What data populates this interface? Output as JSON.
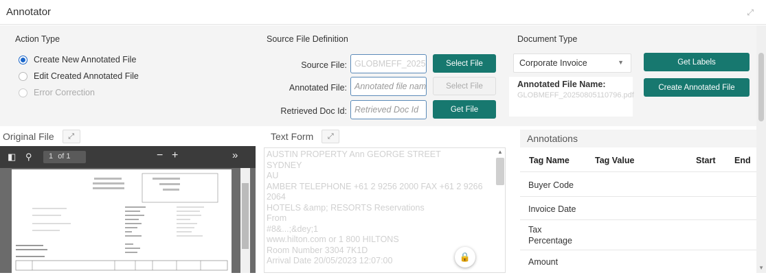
{
  "window": {
    "title": "Annotator"
  },
  "action_type": {
    "label": "Action Type",
    "options": [
      {
        "label": "Create New Annotated File",
        "selected": true,
        "disabled": false
      },
      {
        "label": "Edit Created Annotated File",
        "selected": false,
        "disabled": false
      },
      {
        "label": "Error Correction",
        "selected": false,
        "disabled": true
      }
    ]
  },
  "source_def": {
    "label": "Source File Definition",
    "source_file_label": "Source File:",
    "source_file_value": "GLOBMEFF_20250",
    "select_file_1": "Select File",
    "annotated_file_label": "Annotated File:",
    "annotated_file_placeholder": "Annotated file nam",
    "select_file_2": "Select File",
    "retrieved_label": "Retrieved Doc Id:",
    "retrieved_placeholder": "Retrieved Doc Id",
    "get_file": "Get File"
  },
  "doc_type": {
    "label": "Document Type",
    "selected": "Corporate Invoice",
    "get_labels": "Get Labels",
    "annotated_name_label": "Annotated File Name:",
    "annotated_name_value": "GLOBMEFF_20250805110796.pdf",
    "create_button": "Create Annotated File"
  },
  "original_file": {
    "title": "Original File",
    "page_input": "1",
    "page_of": "of 1"
  },
  "text_form": {
    "title": "Text Form",
    "lines": [
      "AUSTIN PROPERTY Ann GEORGE STREET",
      "SYDNEY",
      "AU",
      "AMBER TELEPHONE +61 2 9256 2000 FAX +61 2 9266",
      "2064",
      "HOTELS &amp; RESORTS Reservations",
      "From",
      "#8&...;&dey;1",
      "www.hilton.com or 1 800 HILTONS",
      "Room Number 3304 7K1D",
      "Arrival Date 20/05/2023 12:07:00"
    ]
  },
  "annotations": {
    "title": "Annotations",
    "columns": [
      "Tag Name",
      "Tag Value",
      "Start",
      "End"
    ],
    "rows": [
      "Buyer Code",
      "Invoice Date",
      "Tax Percentage",
      "Amount"
    ]
  }
}
